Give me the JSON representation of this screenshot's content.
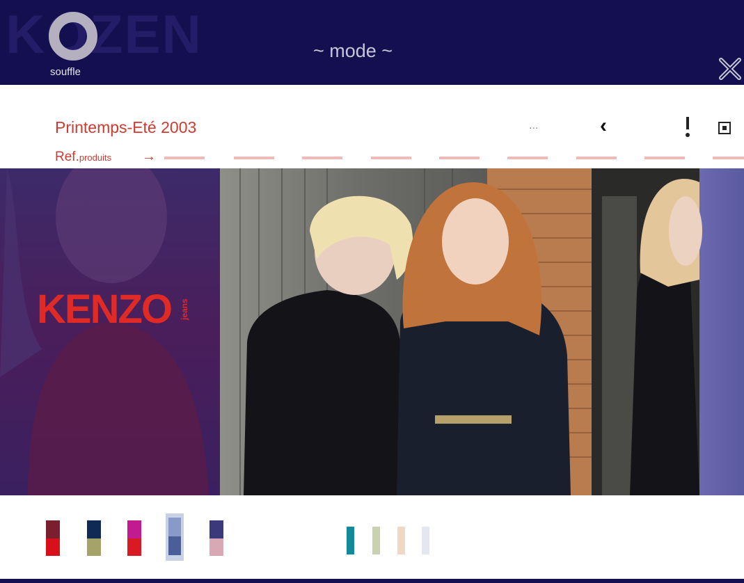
{
  "header": {
    "wordmark": "KOZEN",
    "logo_label": "souffle",
    "title": "~ mode ~",
    "close_icon": "close-icon"
  },
  "toolbar": {
    "collection_title": "Printemps-Eté 2003",
    "ref_label": "Ref.",
    "ref_sub": "produits",
    "ref_arrow": "→",
    "ellipsis": "...",
    "prev_icon": "chevron-left-icon",
    "info_icon": "exclamation-icon",
    "fullscreen_icon": "square-dot-icon"
  },
  "photo": {
    "brand_name": "KENZO",
    "brand_sub": "jeans"
  },
  "swatches": {
    "main": [
      {
        "top": "#7a1f2e",
        "bottom": "#d8101a"
      },
      {
        "top": "#0e2a55",
        "bottom": "#a6a36a"
      },
      {
        "top": "#c21a8f",
        "bottom": "#d81a24"
      },
      {
        "top": "#8a9ac8",
        "bottom": "#4a5e98"
      },
      {
        "top": "#3a3a7a",
        "bottom": "#d8a8b4"
      }
    ],
    "secondary": [
      "#138a9a",
      "#c8d2b0",
      "#f0d8c4",
      "#e4e6f0"
    ]
  },
  "colors": {
    "header_bg": "#141050",
    "accent_red": "#cc3b30",
    "brand_red": "#e02a26"
  }
}
